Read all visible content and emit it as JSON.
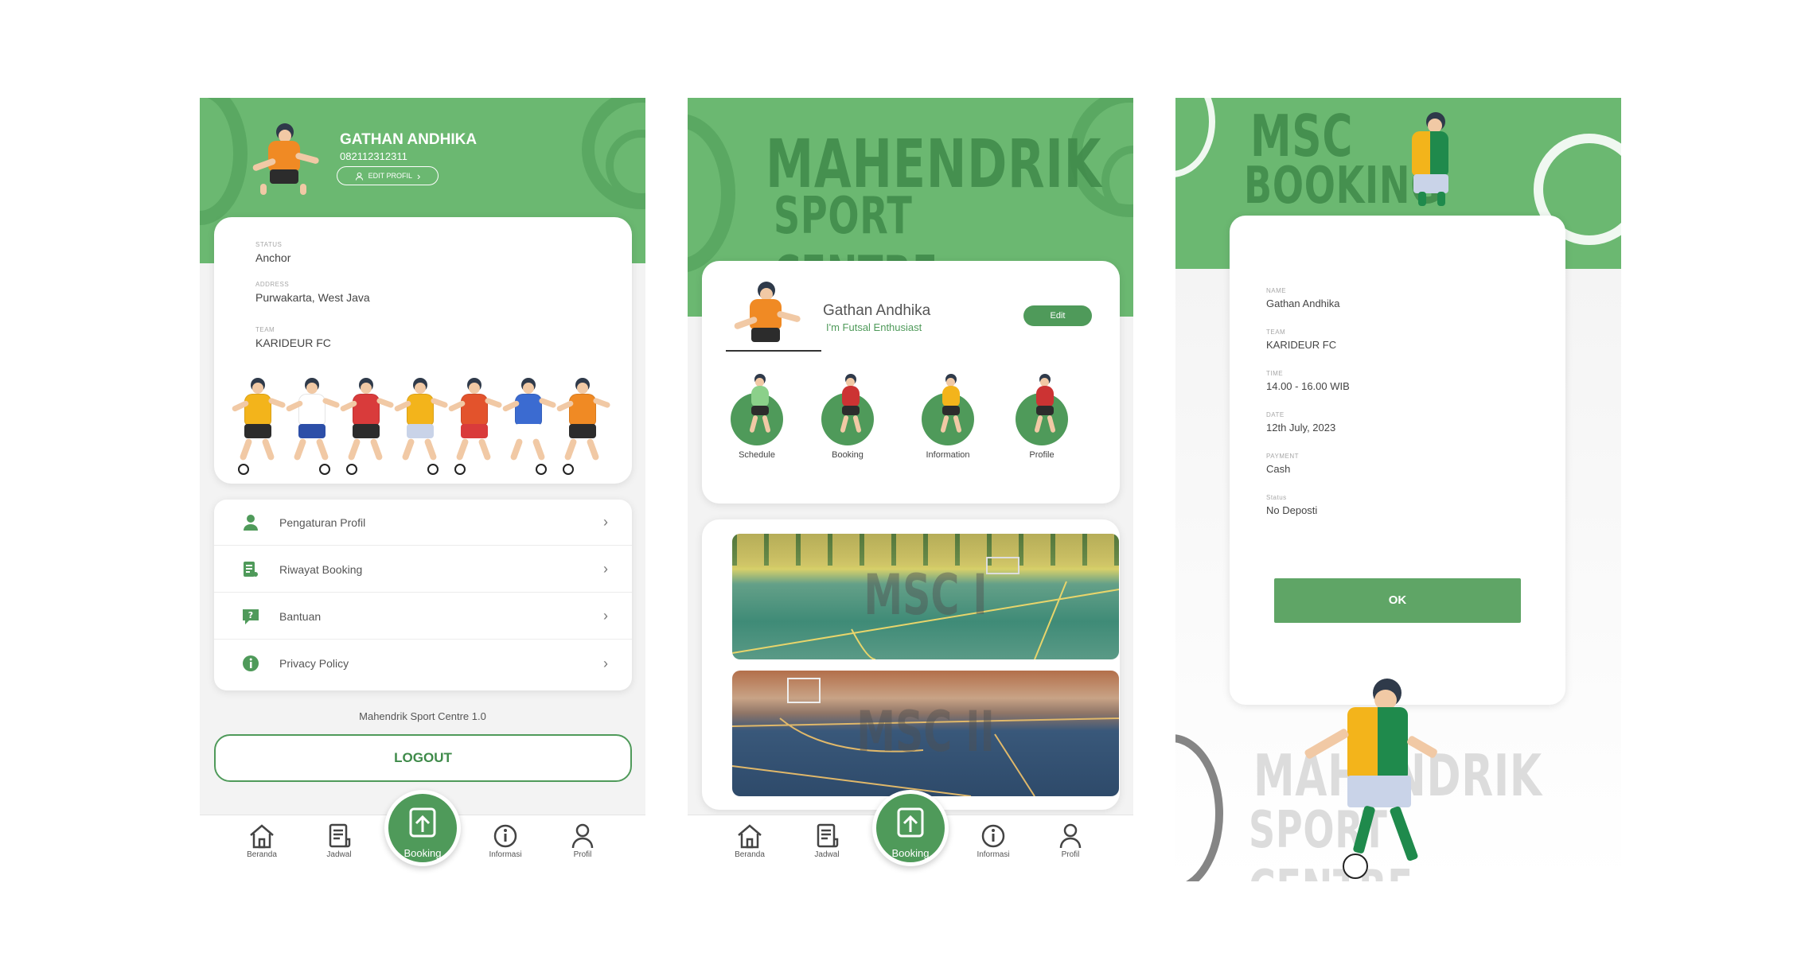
{
  "screen1": {
    "user_name": "GATHAN ANDHIKA",
    "phone": "082112312311",
    "edit_profile": "EDIT PROFIL",
    "fields": [
      {
        "label": "STATUS",
        "value": "Anchor"
      },
      {
        "label": "ADDRESS",
        "value": "Purwakarta, West Java"
      },
      {
        "label": "TEAM",
        "value": "KARIDEUR FC"
      }
    ],
    "menu": [
      {
        "label": "Pengaturan Profil",
        "icon": "user-icon"
      },
      {
        "label": "Riwayat Booking",
        "icon": "document-icon"
      },
      {
        "label": "Bantuan",
        "icon": "help-icon"
      },
      {
        "label": "Privacy Policy",
        "icon": "info-icon"
      }
    ],
    "version": "Mahendrik Sport Centre 1.0",
    "logout": "LOGOUT"
  },
  "screen2": {
    "title_line1": "MAHENDRIK",
    "title_line2": "SPORT CENTRE",
    "user_name": "Gathan Andhika",
    "tagline": "I'm Futsal Enthusiast",
    "edit": "Edit",
    "shortcuts": [
      {
        "label": "Schedule"
      },
      {
        "label": "Booking"
      },
      {
        "label": "Information"
      },
      {
        "label": "Profile"
      }
    ],
    "courts": [
      {
        "label": "MSC I"
      },
      {
        "label": "MSC II"
      }
    ]
  },
  "screen3": {
    "title_line1": "MSC",
    "title_line2": "BOOKING",
    "fields": [
      {
        "label": "NAME",
        "value": "Gathan Andhika"
      },
      {
        "label": "TEAM",
        "value": "KARIDEUR FC"
      },
      {
        "label": "TIME",
        "value": "14.00 - 16.00 WIB"
      },
      {
        "label": "DATE",
        "value": "12th July, 2023"
      },
      {
        "label": "PAYMENT",
        "value": "Cash"
      },
      {
        "label": "Status",
        "value": "No Deposti"
      }
    ],
    "ok": "OK",
    "watermark_line1": "MAHENDRIK",
    "watermark_line2": "SPORT CENTRE"
  },
  "nav": {
    "items": [
      "Beranda",
      "Jadwal",
      "Booking",
      "Informasi",
      "Profil"
    ]
  },
  "colors": {
    "primary_green": "#6bb871",
    "dark_green": "#4f9a5a"
  }
}
